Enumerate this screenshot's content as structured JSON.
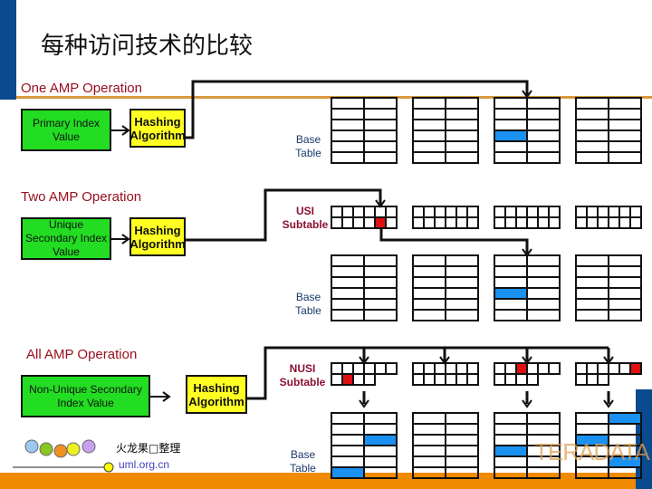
{
  "title": "每种访问技术的比较",
  "colors": {
    "accent_blue": "#0a4a8f",
    "orange": "#f08a00",
    "row_highlight": "#1a90f0",
    "index_highlight": "#e01010"
  },
  "sections": [
    {
      "heading": "One AMP Operation",
      "input": "Primary Index Value",
      "hash": "Hashing Algorithm",
      "base_label": "Base Table"
    },
    {
      "heading": "Two AMP Operation",
      "input": "Unique Secondary Index Value",
      "hash": "Hashing Algorithm",
      "subtable_label": "USI Subtable",
      "base_label": "Base Table"
    },
    {
      "heading": "All AMP Operation",
      "input": "Non-Unique Secondary Index Value",
      "hash": "Hashing Algorithm",
      "subtable_label": "NUSI Subtable",
      "base_label": "Base Table"
    }
  ],
  "footer": {
    "credit": "火龙果□整理",
    "site": "uml.org.cn",
    "brand": "TERADATA"
  }
}
